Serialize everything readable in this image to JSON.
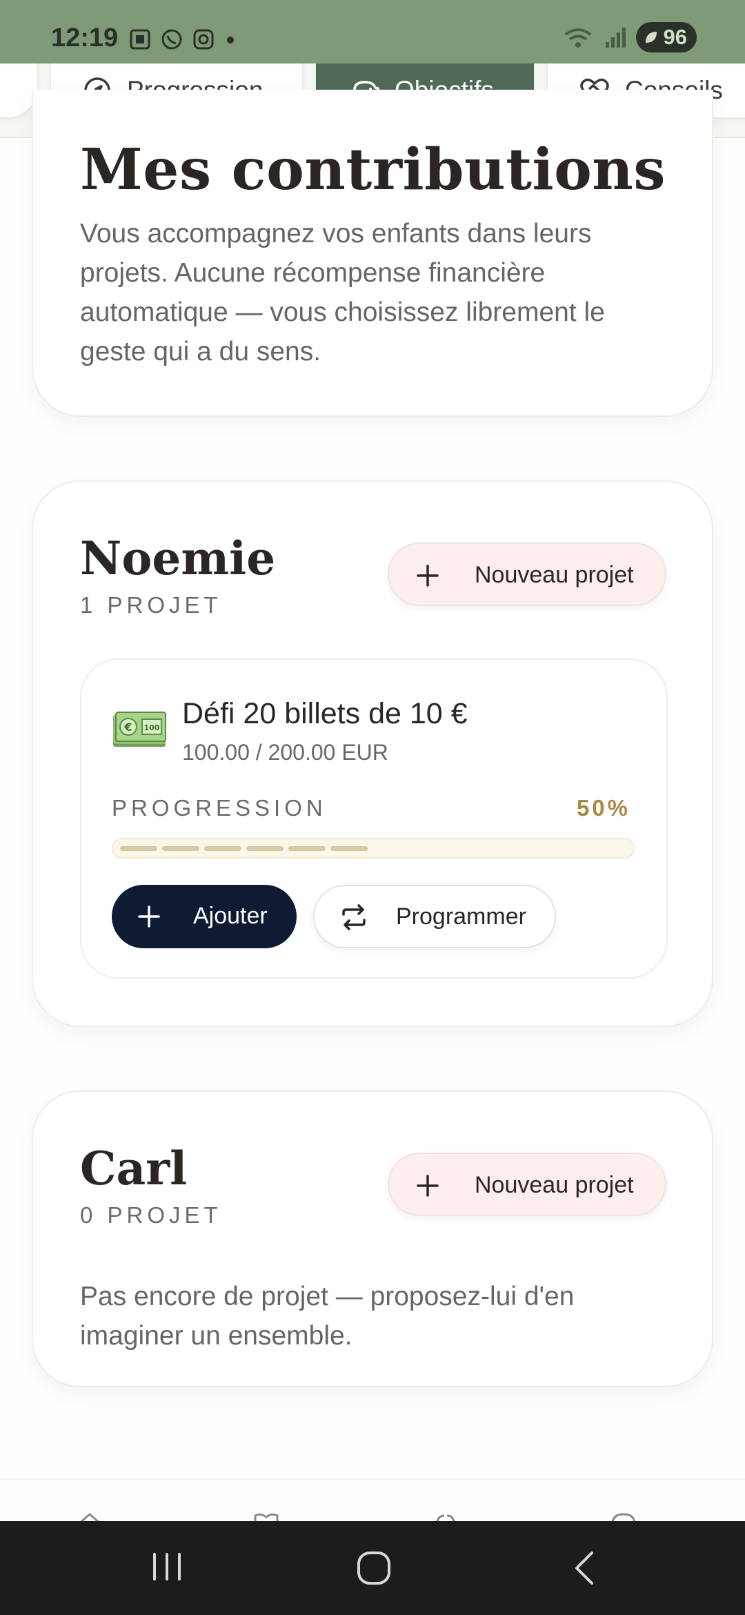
{
  "status": {
    "time": "12:19",
    "battery": "96"
  },
  "tabs": [
    {
      "label": "Progression",
      "icon": "compass-icon"
    },
    {
      "label": "Objectifs",
      "icon": "piggy-bank-icon",
      "active": true
    },
    {
      "label": "Conseils",
      "icon": "heart-handshake-icon"
    }
  ],
  "intro": {
    "title": "Mes contributions",
    "text": "Vous accompagnez vos enfants dans leurs projets. Aucune récompense financière automatique — vous choisissez librement le geste qui a du sens."
  },
  "children": [
    {
      "name": "Noemie",
      "count": "1 PROJET",
      "new_button": "Nouveau projet",
      "projects": [
        {
          "emoji_icon": "banknote-euro-icon",
          "title": "Défi 20 billets de 10 €",
          "amount": "100.00 / 200.00 EUR",
          "progress_label": "PROGRESSION",
          "progress_pct_text": "50%",
          "progress_value": 0.5,
          "add_button": "Ajouter",
          "schedule_button": "Programmer"
        }
      ]
    },
    {
      "name": "Carl",
      "count": "0 PROJET",
      "new_button": "Nouveau projet",
      "empty_text": "Pas encore de projet — proposez-lui d'en imaginer un ensemble."
    }
  ],
  "colors": {
    "status_bar": "#7f9a77",
    "active_tab": "#4f6b58",
    "primary_button": "#0e1b33",
    "new_project_button": "#fbeeec",
    "progress_accent": "#a8884a"
  }
}
